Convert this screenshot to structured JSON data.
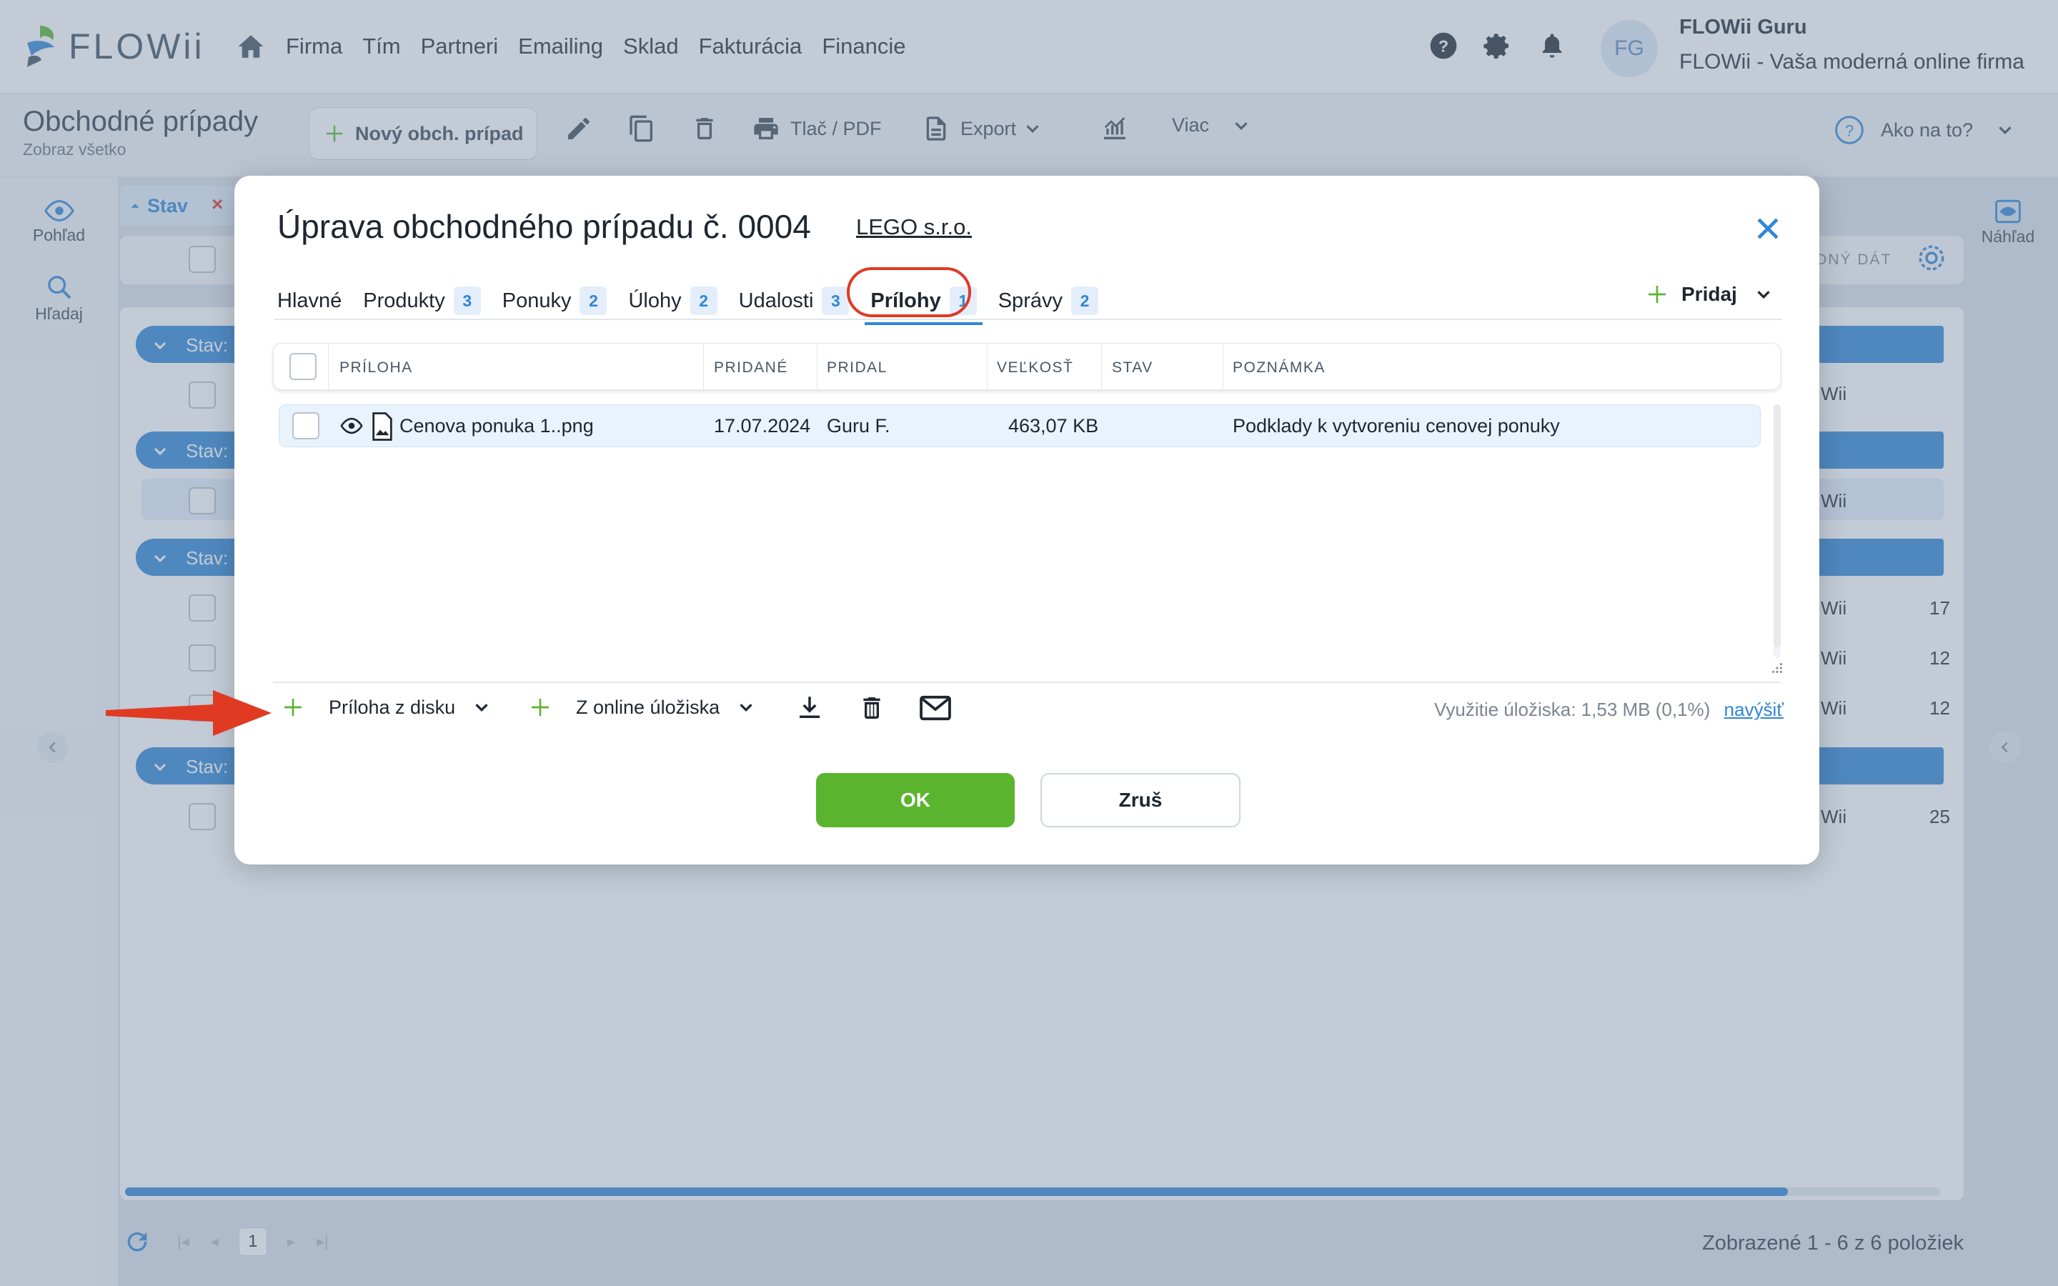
{
  "app": {
    "logo_text": "FLOWii"
  },
  "main_nav": [
    "Firma",
    "Tím",
    "Partneri",
    "Emailing",
    "Sklad",
    "Fakturácia",
    "Financie"
  ],
  "user": {
    "initials": "FG",
    "name": "FLOWii Guru",
    "company": "FLOWii - Vaša moderná online firma"
  },
  "page": {
    "title": "Obchodné prípady",
    "subtitle": "Zobraz všetko"
  },
  "toolbar": {
    "new_label": "Nový obch. prípad",
    "print_label": "Tlač / PDF",
    "export_label": "Export",
    "more_label": "Viac",
    "help_label": "Ako na to?"
  },
  "left_rail": [
    {
      "label": "Pohľad",
      "icon": "eye-icon"
    },
    {
      "label": "Hľadaj",
      "icon": "search-icon"
    }
  ],
  "right_rail": {
    "label": "Náhľad",
    "icon": "preview-icon"
  },
  "background": {
    "filter_chip": "Stav",
    "header_fragment": "ONÝ   DÁT",
    "groups": [
      "Stav: 5",
      "Stav: 7",
      "Stav: U",
      "Stav: N"
    ],
    "row_fragments": [
      {
        "owner": "Wii",
        "num": ""
      },
      {
        "owner": "Wii",
        "num": ""
      },
      {
        "owner": "Wii",
        "num": "17"
      },
      {
        "owner": "Wii",
        "num": "12"
      },
      {
        "owner": "Wii",
        "num": "12"
      },
      {
        "owner": "Wii",
        "num": "25"
      }
    ],
    "footer_count": "Zobrazené 1 - 6 z 6 položiek",
    "pager_current": "1"
  },
  "modal": {
    "title": "Úprava obchodného prípadu č. 0004",
    "partner_link": "LEGO s.r.o.",
    "tabs": [
      {
        "label": "Hlavné",
        "count": ""
      },
      {
        "label": "Produkty",
        "count": "3"
      },
      {
        "label": "Ponuky",
        "count": "2"
      },
      {
        "label": "Úlohy",
        "count": "2"
      },
      {
        "label": "Udalosti",
        "count": "3"
      },
      {
        "label": "Prílohy",
        "count": "1"
      },
      {
        "label": "Správy",
        "count": "2"
      }
    ],
    "active_tab": "Prílohy",
    "add_label": "Pridaj",
    "columns": [
      "PRÍLOHA",
      "PRIDANÉ",
      "PRIDAL",
      "VEĽKOSŤ",
      "STAV",
      "POZNÁMKA"
    ],
    "rows": [
      {
        "name": "Cenova ponuka 1..png",
        "added": "17.07.2024",
        "by": "Guru F.",
        "size": "463,07 KB",
        "status": "",
        "note": "Podklady k vytvoreniu cenovej ponuky"
      }
    ],
    "bottom": {
      "from_disk": "Príloha z disku",
      "from_online": "Z online úložiska",
      "storage_label": "Využitie úložiska:",
      "storage_value": "1,53 MB (0,1%)",
      "upgrade_link": "navýšiť"
    },
    "ok_label": "OK",
    "cancel_label": "Zruš"
  },
  "colors": {
    "accent": "#2f86d6",
    "ok": "#5bb42e",
    "highlight": "#e03a23"
  }
}
